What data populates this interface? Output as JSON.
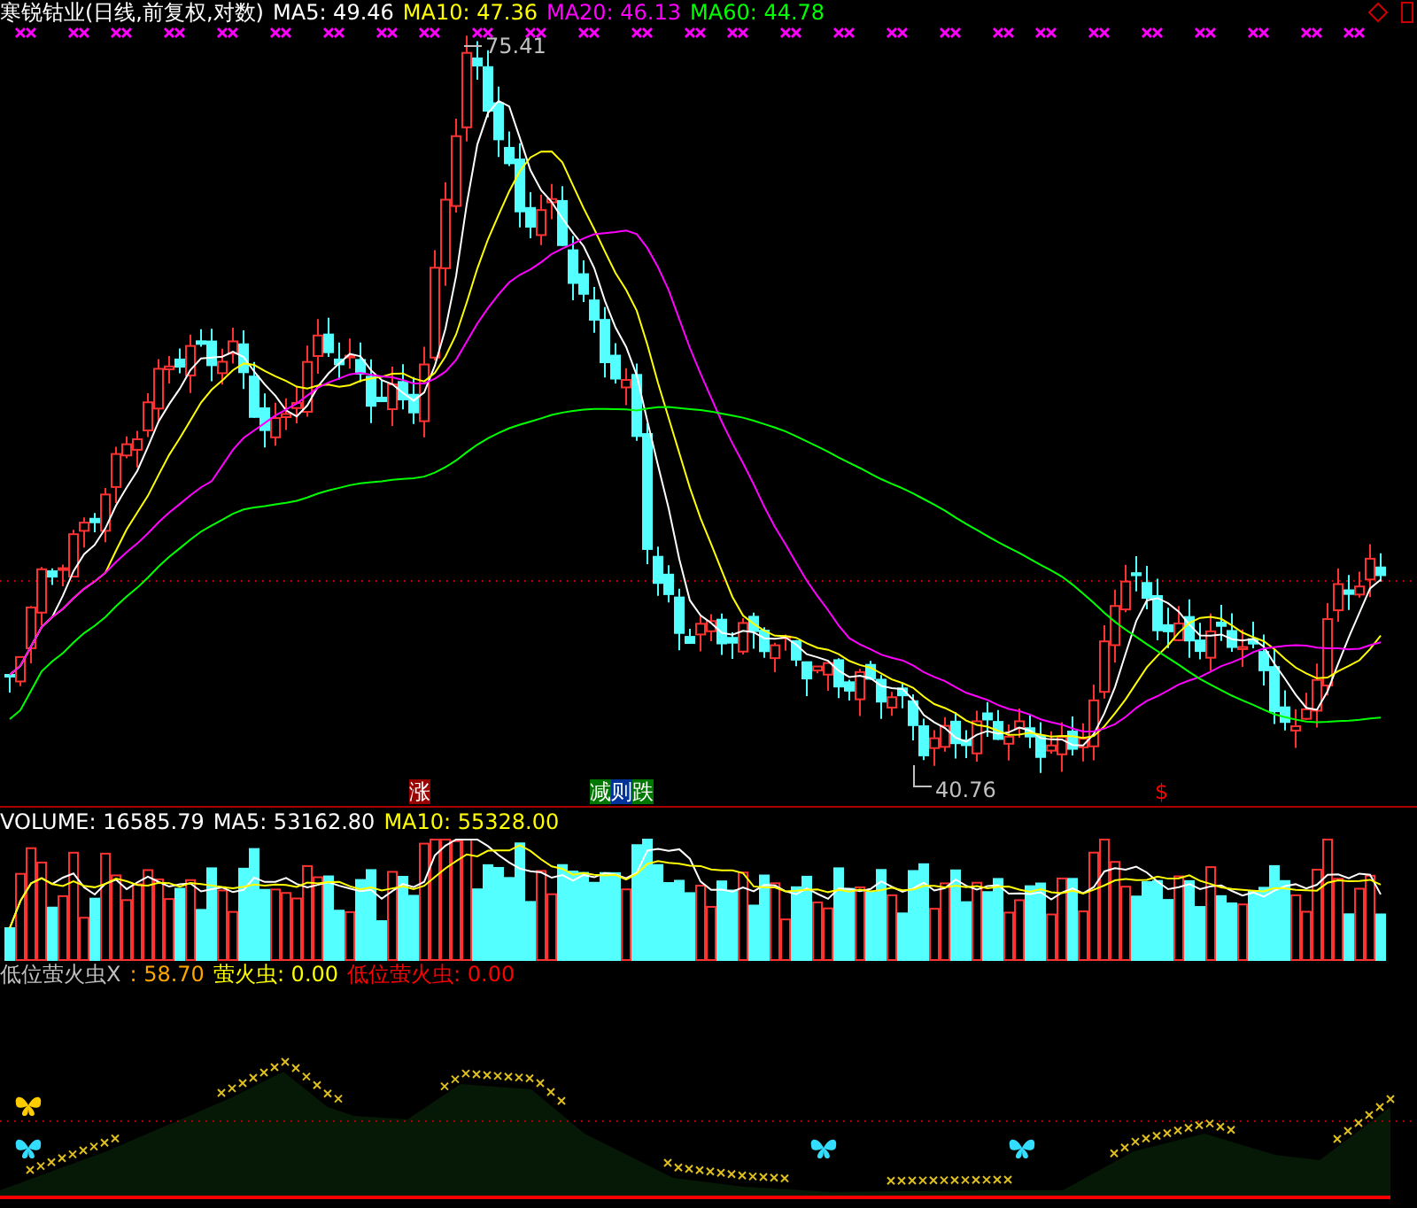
{
  "price_panel": {
    "title": "寒锐钴业(日线,前复权,对数)",
    "legend": [
      {
        "label": "MA5: 49.46",
        "color": "#ffffff"
      },
      {
        "label": "MA10: 47.36",
        "color": "#ffff00"
      },
      {
        "label": "MA20: 46.13",
        "color": "#ff00ff"
      },
      {
        "label": "MA60: 44.78",
        "color": "#00ff00"
      }
    ],
    "high_label": "75.41",
    "low_label": "40.76",
    "signals": [
      {
        "kind": "tag",
        "chars": [
          {
            "text": "涨",
            "color": "#990000"
          }
        ]
      },
      {
        "kind": "tag",
        "chars": [
          {
            "text": "减",
            "color": "#007700"
          },
          {
            "text": "则",
            "color": "#003399"
          },
          {
            "text": "跌",
            "color": "#007700"
          }
        ]
      },
      {
        "kind": "plain",
        "chars": [
          {
            "text": "$",
            "color": "#ff0000"
          }
        ]
      }
    ]
  },
  "volume_panel": {
    "legend": [
      {
        "label": "VOLUME: 16585.79",
        "color": "#ffffff"
      },
      {
        "label": "MA5: 53162.80",
        "color": "#ffffff"
      },
      {
        "label": "MA10: 55328.00",
        "color": "#ffff00"
      }
    ]
  },
  "indicator_panel": {
    "legend": [
      {
        "label": "低位萤火虫X",
        "color": "#c0c0c0"
      },
      {
        "label": ": 58.70",
        "color": "#ffa500"
      },
      {
        "label": "萤火虫: 0.00",
        "color": "#ffff00"
      },
      {
        "label": "低位萤火虫: 0.00",
        "color": "#ff0000"
      }
    ]
  }
}
